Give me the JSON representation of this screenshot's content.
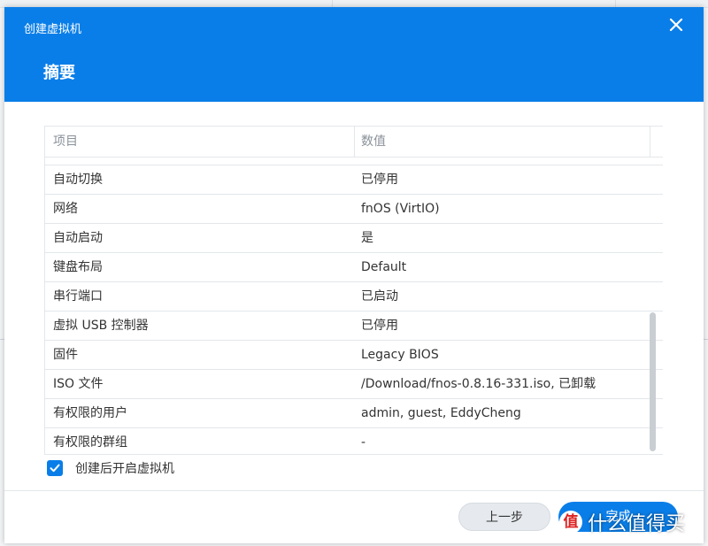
{
  "dialog": {
    "title": "创建虚拟机",
    "step_title": "摘要"
  },
  "table": {
    "headers": [
      "项目",
      "数值"
    ],
    "rows": [
      {
        "item": "自动切换",
        "value": "已停用"
      },
      {
        "item": "网络",
        "value": "fnOS (VirtIO)"
      },
      {
        "item": "自动启动",
        "value": "是"
      },
      {
        "item": "键盘布局",
        "value": "Default"
      },
      {
        "item": "串行端口",
        "value": "已启动"
      },
      {
        "item": "虚拟 USB 控制器",
        "value": "已停用"
      },
      {
        "item": "固件",
        "value": "Legacy BIOS"
      },
      {
        "item": "ISO 文件",
        "value": "/Download/fnos-0.8.16-331.iso, 已卸载"
      },
      {
        "item": "有权限的用户",
        "value": "admin, guest, EddyCheng"
      },
      {
        "item": "有权限的群组",
        "value": "-"
      }
    ]
  },
  "options": {
    "start_after_create_label": "创建后开启虚拟机",
    "start_after_create_checked": true
  },
  "buttons": {
    "prev_label": "上一步",
    "done_label": "完成"
  },
  "watermark": {
    "logo_char": "值",
    "text": "什么值得买"
  },
  "colors": {
    "accent": "#0a7ee8"
  }
}
